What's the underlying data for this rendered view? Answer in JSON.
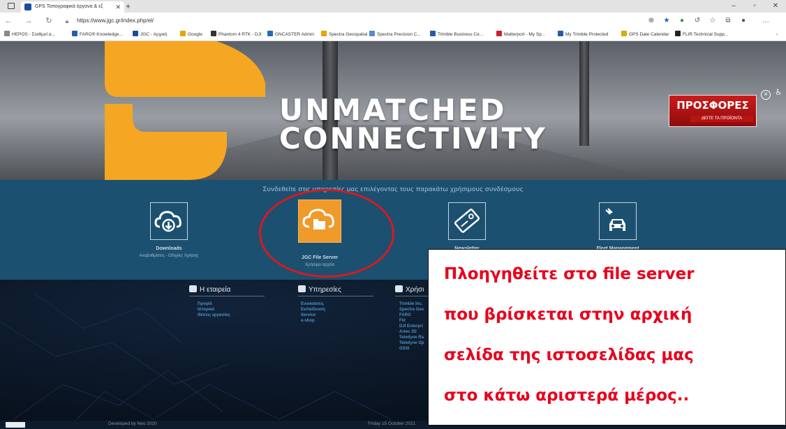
{
  "browser": {
    "tab_title": "GPS Τοπογραφικά όργανα & εξ",
    "url": "https://www.jgc.gr/index.php/el/",
    "bookmarks": [
      {
        "label": "HEPOS - Σταθμοί α...",
        "color": "#888888"
      },
      {
        "label": "FARO® Knowledge...",
        "color": "#1e60b0"
      },
      {
        "label": "JGC - Αρχική",
        "color": "#1a4f9c"
      },
      {
        "label": "Google",
        "color": "#e0a800"
      },
      {
        "label": "Phantom 4 RTK - DJI",
        "color": "#333333"
      },
      {
        "label": "GNCASTER Admin",
        "color": "#2a6bb8"
      },
      {
        "label": "Spectra Geospatial",
        "color": "#e8a300"
      },
      {
        "label": "Spectra Precision C...",
        "color": "#5b8bd0"
      },
      {
        "label": "Trimble Business Ce...",
        "color": "#1f5fa6"
      },
      {
        "label": "Matterport - My Sp...",
        "color": "#cc2233"
      },
      {
        "label": "My Trimble Protected",
        "color": "#1f5fa6"
      },
      {
        "label": "GPS Date Calendar",
        "color": "#e0a800"
      },
      {
        "label": "FLIR Technical Supp...",
        "color": "#222222"
      }
    ]
  },
  "hero": {
    "line1": "UNMATCHED",
    "line2": "CONNECTIVITY",
    "promo_title": "ΠΡΟΣΦΟΡΕΣ",
    "promo_sub": "ΔΕΙΤΕ ΤΑ ΠΡΟΪΟΝΤΑ",
    "accent": "#f5a623"
  },
  "services": {
    "heading": "Συνδεθείτε στις υπηρεσίες μας επιλέγοντας τους παρακάτω χρήσιμους συνδέσμους",
    "items": [
      {
        "title": "Downloads",
        "subtitle": "Αναβαθμίσεις - Οδηγίες Χρήσης",
        "icon": "cloud-download-icon"
      },
      {
        "title": "JGC File Server",
        "subtitle": "Χρήσιμα αρχεία",
        "icon": "cloud-folder-icon"
      },
      {
        "title": "Newsletter",
        "subtitle": "Εγγ",
        "icon": "newsletter-card-icon"
      },
      {
        "title": "Fleet Management",
        "subtitle": "",
        "icon": "car-satellite-icon"
      }
    ]
  },
  "footer": {
    "columns": [
      {
        "title": "Η εταιρεία",
        "items": [
          "Προφίλ",
          "Ιστορικό",
          "Θέσεις εργασίας"
        ]
      },
      {
        "title": "Υπηρεσίες",
        "items": [
          "Ενοικιάσεις",
          "Εκπαίδευση",
          "Service",
          "e-shop"
        ]
      },
      {
        "title": "Χρήσι",
        "items": [
          "Trimble Inc.",
          "Spectra Geo",
          "FARO",
          "Flir",
          "DJI Enterpri",
          "Artec 3D",
          "Teledyne Ra",
          "Teledyne Op",
          "GSSI"
        ]
      }
    ],
    "developed_by": "Developed by Neo 2020",
    "date": "Friday 15 October 2021"
  },
  "annotation": {
    "lines": [
      "Πλοηγηθείτε στο file server",
      "που βρίσκεται στην αρχική",
      "σελίδα της ιστοσελίδας μας",
      "στο κάτω αριστερά μέρος.."
    ],
    "color": "#e8001c"
  }
}
